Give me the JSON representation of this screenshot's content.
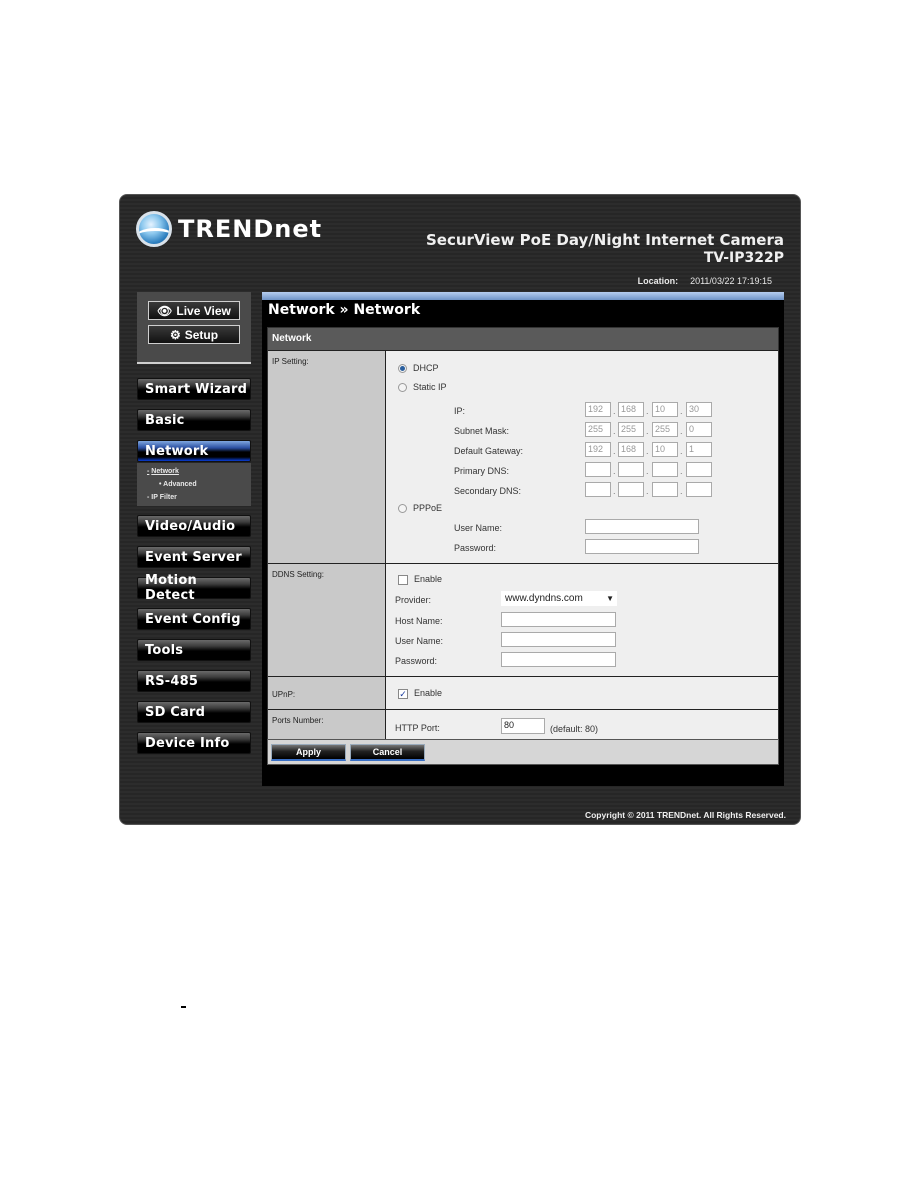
{
  "header": {
    "brand": "TRENDnet",
    "product_title": "SecurView PoE Day/Night Internet Camera",
    "model": "TV-IP322P",
    "location_label": "Location:",
    "datetime": "2011/03/22 17:19:15"
  },
  "sidebar": {
    "top_buttons": [
      {
        "label": "Live View",
        "icon": "eye-icon"
      },
      {
        "label": "Setup",
        "icon": "gears-icon"
      }
    ],
    "items": [
      {
        "label": "Smart Wizard"
      },
      {
        "label": "Basic"
      },
      {
        "label": "Network",
        "active": true
      },
      {
        "label": "Video/Audio"
      },
      {
        "label": "Event Server"
      },
      {
        "label": "Motion Detect"
      },
      {
        "label": "Event Config"
      },
      {
        "label": "Tools"
      },
      {
        "label": "RS-485"
      },
      {
        "label": "SD Card"
      },
      {
        "label": "Device Info"
      }
    ],
    "subitems": [
      {
        "label": "Network",
        "bullet": "-",
        "current": true
      },
      {
        "label": "Advanced",
        "bullet": "•"
      },
      {
        "label": "IP Filter",
        "bullet": "-"
      }
    ]
  },
  "main": {
    "page_title": "Network » Network",
    "panel_title": "Network",
    "ip_setting": {
      "label": "IP Setting:",
      "options": [
        {
          "label": "DHCP",
          "selected": true
        },
        {
          "label": "Static IP",
          "selected": false
        },
        {
          "label": "PPPoE",
          "selected": false
        }
      ],
      "static_fields": [
        {
          "label": "IP:",
          "octets": [
            "192",
            "168",
            "10",
            "30"
          ]
        },
        {
          "label": "Subnet Mask:",
          "octets": [
            "255",
            "255",
            "255",
            "0"
          ]
        },
        {
          "label": "Default Gateway:",
          "octets": [
            "192",
            "168",
            "10",
            "1"
          ]
        },
        {
          "label": "Primary DNS:",
          "octets": [
            "",
            "",
            "",
            ""
          ]
        },
        {
          "label": "Secondary DNS:",
          "octets": [
            "",
            "",
            "",
            ""
          ]
        }
      ],
      "pppoe_fields": [
        {
          "label": "User Name:",
          "value": ""
        },
        {
          "label": "Password:",
          "value": ""
        }
      ]
    },
    "ddns": {
      "label": "DDNS Setting:",
      "enable_label": "Enable",
      "enabled": false,
      "provider_label": "Provider:",
      "provider_value": "www.dyndns.com",
      "host_label": "Host Name:",
      "host_value": "",
      "user_label": "User Name:",
      "user_value": "",
      "password_label": "Password:",
      "password_value": ""
    },
    "upnp": {
      "label": "UPnP:",
      "enable_label": "Enable",
      "enabled": true,
      "check_glyph": "✓"
    },
    "ports": {
      "label": "Ports Number:",
      "http_label": "HTTP Port:",
      "http_value": "80",
      "default_note": "(default: 80)"
    },
    "buttons": {
      "apply": "Apply",
      "cancel": "Cancel"
    }
  },
  "footer": {
    "copyright": "Copyright © 2011 TRENDnet. All Rights Reserved."
  }
}
